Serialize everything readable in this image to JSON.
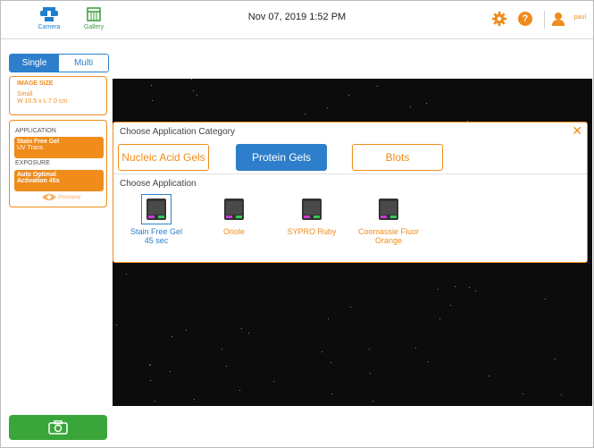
{
  "header": {
    "nav": [
      {
        "label": "Camera",
        "icon": "camera-nav-icon"
      },
      {
        "label": "Gallery",
        "icon": "gallery-icon"
      }
    ],
    "datetime": "Nov 07, 2019  1:52 PM",
    "help_label": "?",
    "user": "paul"
  },
  "sidebar": {
    "mode": {
      "single": "Single",
      "multi": "Multi",
      "selected": "Single"
    },
    "image_size": {
      "heading": "IMAGE SIZE",
      "value1": "Small",
      "value2": "W 10.5 x L 7.0 cm"
    },
    "application": {
      "heading": "APPLICATION",
      "value1": "Stain Free Gel",
      "value2": "UV Trans"
    },
    "exposure": {
      "heading": "EXPOSURE",
      "value1": "Auto Optimal",
      "value2": "Activation 45s"
    },
    "preview_label": "Preview"
  },
  "dialog": {
    "title": "Choose Application Category",
    "close": "✕",
    "categories": [
      {
        "label": "Nucleic Acid Gels",
        "selected": false
      },
      {
        "label": "Protein Gels",
        "selected": true
      },
      {
        "label": "Blots",
        "selected": false
      }
    ],
    "subtitle": "Choose Application",
    "applications": [
      {
        "line1": "Stain Free Gel",
        "line2": "45 sec",
        "selected": true
      },
      {
        "line1": "Oriole",
        "line2": "",
        "selected": false
      },
      {
        "line1": "SYPRO Ruby",
        "line2": "",
        "selected": false
      },
      {
        "line1": "Coomassie Fluor",
        "line2": "Orange",
        "selected": false
      }
    ]
  },
  "colors": {
    "accent": "#ef8c1c",
    "primary": "#2e7fcb",
    "capture": "#3aa53a"
  }
}
